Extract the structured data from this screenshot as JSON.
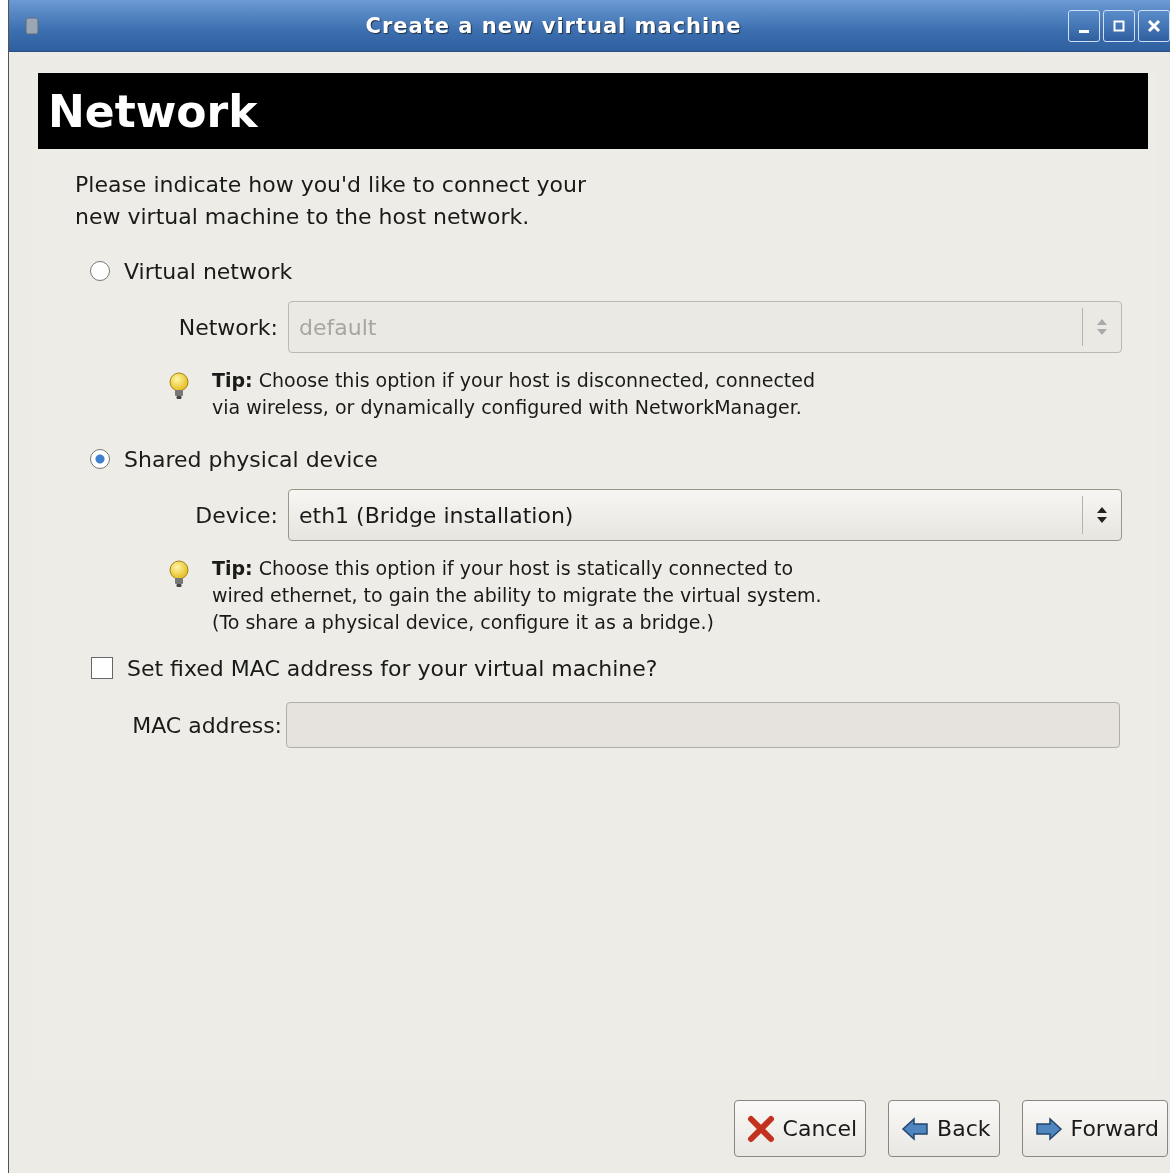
{
  "window": {
    "title": "Create a new virtual machine"
  },
  "page_title": "Network",
  "intro": "Please indicate how you'd like to connect your\nnew virtual machine to the host network.",
  "options": [
    {
      "label": "Virtual network",
      "selected": false,
      "field": {
        "label": "Network:",
        "value": "default",
        "disabled": true
      },
      "tip": "**Tip:** Choose this option if your host is disconnected, connected\nvia wireless, or dynamically configured with NetworkManager."
    },
    {
      "label": "Shared physical device",
      "selected": true,
      "field": {
        "label": "Device:",
        "value": "eth1 (Bridge installation)",
        "disabled": false
      },
      "tip": "**Tip:** Choose this option if your host is statically connected to\nwired ethernet, to gain the ability to migrate the virtual system.\n(To share a physical device, configure it as a bridge.)"
    }
  ],
  "mac": {
    "label": "Set fixed MAC address for your virtual machine?",
    "checked": false,
    "field_label": "MAC address:",
    "field_disabled": true
  },
  "buttons": [
    {
      "kind": "cancel",
      "label": "Cancel"
    },
    {
      "kind": "back",
      "label": "Back"
    },
    {
      "kind": "forward",
      "label": "Forward"
    }
  ]
}
